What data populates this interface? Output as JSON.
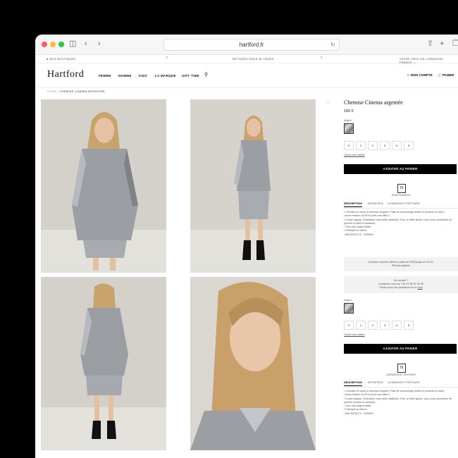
{
  "browser": {
    "url": "hartford.fr",
    "icons": {
      "sidebar": "sidebar-icon",
      "back": "chevron-left-icon",
      "forward": "chevron-right-icon",
      "reload": "reload-icon",
      "share": "share-icon",
      "new_tab": "plus-icon",
      "tabs": "tabs-icon"
    }
  },
  "announcement": {
    "left": "NOS BOUTIQUES",
    "center": "RETOURS SOUS 30 JOURS",
    "right": "VOTRE PAYS DE LIVRAISON : FRANCE"
  },
  "header": {
    "logo": "Hartford",
    "nav": [
      "FEMME",
      "HOMME",
      "KIDS",
      "LA MARQUE",
      "GIFT TIME"
    ],
    "account": "MON COMPTE",
    "cart": "PANIER"
  },
  "breadcrumb": {
    "home": "HOME",
    "sep": "/",
    "current": "CHEMISE CINEMA ARGENTÉE"
  },
  "product": {
    "title": "Chemise Cinema argentée",
    "price": "160 €",
    "color_label": "Argent",
    "sizes": [
      "0",
      "1",
      "2",
      "3",
      "4",
      "5"
    ],
    "size_guide": "Guide des tailles",
    "add_to_cart": "AJOUTER AU PANIER",
    "crest_letter": "H",
    "crest_label": "Usine Parisienne",
    "tabs": [
      "DESCRIPTION",
      "ENTRETIEN",
      "LIVRAISON ET RETOURS"
    ],
    "tabs_compact": [
      "DESCRIPTION",
      "ENTRETIEN",
      "LIVRAISON ET RETOURS"
    ],
    "bullets": [
      "Chemise en coton à manches longues. Patte de boutonnage visible et boutons en nacre.",
      "Anne mesure 1m78 et porte une taille 2.",
      "Coupe regular. Choisissez votre taille habituelle. Pour un effet ajusté, nous vous conseillons de prendre la taille en-dessous.",
      "Tous tons argent fluide",
      "Fabriqué au Maroc",
      "BACDEZ6-C5 - CINEMA"
    ],
    "shipping_line1": "Livraison express offerte à partir de 200€ jusqu'au 22/12.",
    "shipping_line2": "Retours gratuits",
    "advice_line1": "Un conseil ?",
    "advice_line2": "Contactez-nous au +33 01 58 59 39 96",
    "advice_line3": "Posez-nous vos questions sur le",
    "advice_link": "chat"
  },
  "photos": [
    "front-full-length",
    "front-full-length-boots",
    "back-full-length",
    "portrait-close-up"
  ],
  "colors": {
    "accent": "#000000",
    "swatch": "#bdbdbd"
  }
}
